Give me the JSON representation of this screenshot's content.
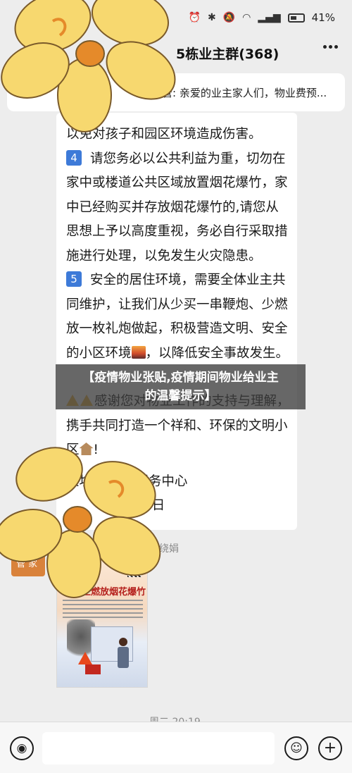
{
  "status_bar": {
    "icons": [
      "alarm-icon",
      "bluetooth-icon",
      "mute-icon",
      "wifi-icon",
      "signal-4g-icon",
      "signal-icon"
    ],
    "battery": "41%"
  },
  "header": {
    "title": "5栋业主群(368)",
    "more_icon": "more-dots-icon"
  },
  "notice": {
    "text": "楼管: 亲爱的业主家人们，物业费预..."
  },
  "message": {
    "lines": [
      "以免对孩子和园区环境造成伤害。",
      "请您务必以公共利益为重，切勿在家中或楼道公共区域放置烟花爆竹，家中已经购买并存放烟花爆竹的,请您从思想上予以高度重视，务必自行采取措施进行处理，以免发生火灾隐患。",
      "安全的居住环境，需要全体业主共同维护，让我们从少买一串鞭炮、少燃放一枚礼炮做起，积极营造文明、安全的小区环境",
      "，以降低安全事故发生。",
      "感谢您对物业工作的支持与理解，携手共同打造一个祥和、环保的文明小区",
      "!",
      "义坊      城物业服务中心",
      "0日"
    ],
    "number_4": "4",
    "number_5": "5"
  },
  "banner": {
    "line1": "【疫情物业张贴,疫情期间物业给业主",
    "line2": "的温馨提示】"
  },
  "second_message": {
    "sender": "楼管家费绕娟",
    "avatar_text": "管家",
    "poster_title": "禁止燃放烟花爆竹"
  },
  "timestamp": "周二 20:19",
  "input_bar": {
    "voice_icon": "voice-icon",
    "emoji_icon": "smiley-icon",
    "plus_icon": "plus-icon"
  }
}
